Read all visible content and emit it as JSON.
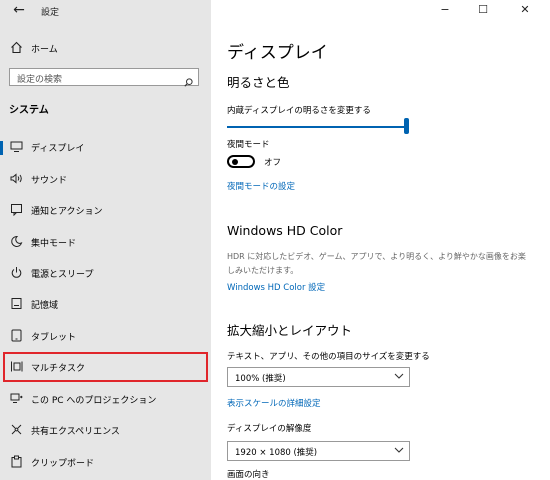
{
  "window": {
    "title": "設定",
    "back_glyph": "←",
    "minimize": "−",
    "maximize": "☐",
    "close": "✕"
  },
  "sidebar": {
    "home_label": "ホーム",
    "search_placeholder": "設定の検索",
    "section_title": "システム",
    "items": [
      {
        "label": "ディスプレイ",
        "icon": "display-icon",
        "active": true
      },
      {
        "label": "サウンド",
        "icon": "speaker-icon"
      },
      {
        "label": "通知とアクション",
        "icon": "notification-icon"
      },
      {
        "label": "集中モード",
        "icon": "moon-icon"
      },
      {
        "label": "電源とスリープ",
        "icon": "power-icon"
      },
      {
        "label": "記憶域",
        "icon": "storage-icon"
      },
      {
        "label": "タブレット",
        "icon": "tablet-icon"
      },
      {
        "label": "マルチタスク",
        "icon": "multitask-icon",
        "highlighted": true
      },
      {
        "label": "この PC へのプロジェクション",
        "icon": "projection-icon"
      },
      {
        "label": "共有エクスペリエンス",
        "icon": "shared-experience-icon"
      },
      {
        "label": "クリップボード",
        "icon": "clipboard-icon"
      }
    ],
    "highlight_color": "#e0252b",
    "accent_color": "#0063b1"
  },
  "main": {
    "page_title": "ディスプレイ",
    "brightness": {
      "heading": "明るさと色",
      "slider_label": "内蔵ディスプレイの明るさを変更する",
      "slider_value": 1.0,
      "night_light_label": "夜間モード",
      "night_light_state": "オフ",
      "night_light_link": "夜間モードの設定"
    },
    "hdr": {
      "heading": "Windows HD Color",
      "description": "HDR に対応したビデオ、ゲーム、アプリで、より明るく、より鮮やかな画像をお楽しみいただけます。",
      "link": "Windows HD Color 設定"
    },
    "scale": {
      "heading": "拡大縮小とレイアウト",
      "size_label": "テキスト、アプリ、その他の項目のサイズを変更する",
      "size_value": "100% (推奨)",
      "advanced_link": "表示スケールの詳細設定",
      "resolution_label": "ディスプレイの解像度",
      "resolution_value": "1920 × 1080 (推奨)",
      "orientation_label": "画面の向き"
    },
    "link_color": "#0067b8"
  }
}
